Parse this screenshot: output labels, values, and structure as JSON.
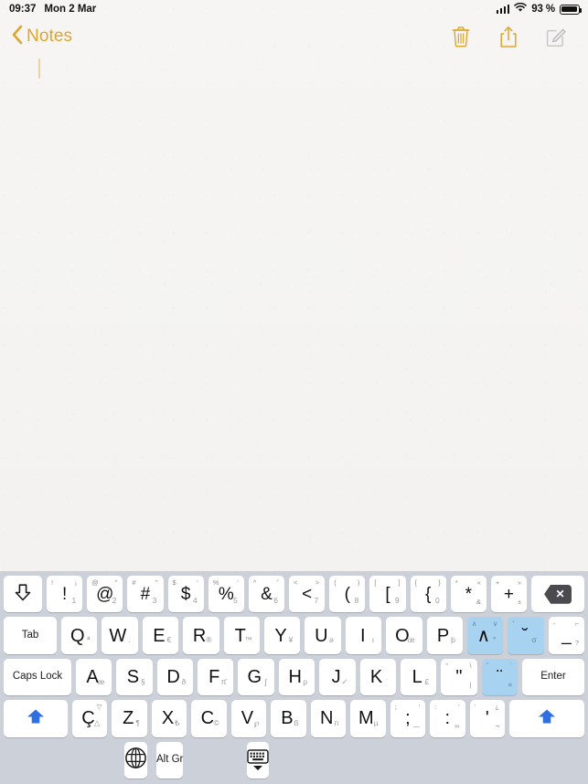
{
  "status_bar": {
    "time": "09:37",
    "date": "Mon 2 Mar",
    "battery_percent": "93 %",
    "signal_icon": "cellular-signal-icon",
    "wifi_icon": "wifi-icon",
    "battery_icon": "battery-icon"
  },
  "nav_bar": {
    "back_label": "Notes",
    "back_chevron_icon": "chevron-left-icon",
    "delete_icon": "trash-icon",
    "share_icon": "share-icon",
    "compose_icon": "compose-icon",
    "accent_color": "#e0a52b",
    "disabled_color": "#bdbdbd"
  },
  "note": {
    "body_text": "",
    "cursor_color": "#e3c98a"
  },
  "keyboard": {
    "layout_name": "Turkish Q",
    "background_color": "#ccd0d8",
    "key_color": "#ffffff",
    "highlight_color": "#a8d3f0",
    "rows": [
      {
        "name": "number-row",
        "keys": [
          {
            "name": "tab-down-key",
            "main": "⇩",
            "type": "icon-tab-down"
          },
          {
            "name": "exclamation-key",
            "main": "!",
            "tl": "!",
            "tr": "¡",
            "sub": "1"
          },
          {
            "name": "at-key",
            "main": "@",
            "tl": "@",
            "tr": "\"",
            "sub": "2"
          },
          {
            "name": "hash-key",
            "main": "#",
            "tl": "#",
            "tr": "\"",
            "sub": "3"
          },
          {
            "name": "dollar-key",
            "main": "$",
            "tl": "$",
            "tr": "'",
            "sub": "4"
          },
          {
            "name": "percent-key",
            "main": "%",
            "tl": "%",
            "tr": "'",
            "sub": "5"
          },
          {
            "name": "ampersand-key",
            "main": "&",
            "tl": "^",
            "tr": "˘",
            "sub": "6"
          },
          {
            "name": "less-than-key",
            "main": "<",
            "tl": "<",
            "tr": ">",
            "sub": "7"
          },
          {
            "name": "paren-open-key",
            "main": "(",
            "tl": "(",
            "tr": ")",
            "sub": "8"
          },
          {
            "name": "bracket-open-key",
            "main": "[",
            "tl": "[",
            "tr": "]",
            "sub": "9"
          },
          {
            "name": "brace-open-key",
            "main": "{",
            "tl": "{",
            "tr": "}",
            "sub": "0"
          },
          {
            "name": "asterisk-key",
            "main": "*",
            "tl": "*",
            "tr": "«",
            "br": "&"
          },
          {
            "name": "plus-key",
            "main": "+",
            "tl": "+",
            "tr": "»",
            "br": "±"
          },
          {
            "name": "backspace-key",
            "main": "⌫",
            "type": "icon-delete"
          }
        ]
      },
      {
        "name": "qwerty-row",
        "keys": [
          {
            "name": "tab-key",
            "main": "Tab",
            "type": "label"
          },
          {
            "name": "q-key",
            "main": "Q",
            "sub": "ª",
            "type": "letter"
          },
          {
            "name": "w-key",
            "main": "W",
            "sub": ".",
            "type": "letter"
          },
          {
            "name": "e-key",
            "main": "E",
            "sub": "€",
            "type": "letter"
          },
          {
            "name": "r-key",
            "main": "R",
            "sub": "®",
            "type": "letter"
          },
          {
            "name": "t-key",
            "main": "T",
            "sub": "™",
            "type": "letter"
          },
          {
            "name": "y-key",
            "main": "Y",
            "sub": "¥",
            "type": "letter"
          },
          {
            "name": "u-key",
            "main": "U",
            "sub": "ə",
            "type": "letter"
          },
          {
            "name": "i-key",
            "main": "I",
            "sub": "ı",
            "type": "letter"
          },
          {
            "name": "o-key",
            "main": "O",
            "sub": "œ",
            "type": "letter"
          },
          {
            "name": "p-key",
            "main": "P",
            "sub": "þ",
            "type": "letter"
          },
          {
            "name": "circumflex-key",
            "main": "∧",
            "tl": "∧",
            "tr": "∨",
            "sub": "°",
            "highlight": true,
            "type": "letter"
          },
          {
            "name": "breve-key",
            "main": "˘",
            "tl": "˘",
            "sub": "σ",
            "highlight": true,
            "type": "letter"
          },
          {
            "name": "underscore-key",
            "main": "_",
            "tl": "-",
            "tr": "⌐",
            "br": "?"
          }
        ]
      },
      {
        "name": "home-row",
        "keys": [
          {
            "name": "caps-lock-key",
            "main": "Caps Lock",
            "type": "label"
          },
          {
            "name": "a-key",
            "main": "A",
            "sub": "æ",
            "type": "letter"
          },
          {
            "name": "s-key",
            "main": "S",
            "sub": "§",
            "type": "letter"
          },
          {
            "name": "d-key",
            "main": "D",
            "sub": "ð",
            "type": "letter"
          },
          {
            "name": "f-key",
            "main": "F",
            "sub": "π̄",
            "type": "letter"
          },
          {
            "name": "g-key",
            "main": "G",
            "sub": "∫",
            "type": "letter"
          },
          {
            "name": "h-key",
            "main": "H",
            "sub": "ρ",
            "type": "letter"
          },
          {
            "name": "j-key",
            "main": "J",
            "sub": "✓",
            "type": "letter"
          },
          {
            "name": "k-key",
            "main": "K",
            "sub": "˙",
            "type": "letter"
          },
          {
            "name": "l-key",
            "main": "L",
            "sub": "£",
            "type": "letter"
          },
          {
            "name": "quote-key",
            "main": "\"",
            "tl": "\"",
            "tr": "\\",
            "br": "|",
            "type": "punct"
          },
          {
            "name": "diaeresis-key",
            "main": "¨",
            "tl": "˝",
            "tr": "´",
            "br": "¤",
            "highlight": true,
            "type": "punct"
          },
          {
            "name": "enter-key",
            "main": "Enter",
            "type": "label"
          }
        ]
      },
      {
        "name": "shift-row",
        "keys": [
          {
            "name": "shift-left-key",
            "main": "⬆",
            "type": "icon-shift"
          },
          {
            "name": "c-cedilla-key",
            "main": "Ç",
            "tr": "▽",
            "sub": "△",
            "type": "letter"
          },
          {
            "name": "z-key",
            "main": "Z",
            "sub": "¶",
            "type": "letter"
          },
          {
            "name": "x-key",
            "main": "X",
            "sub": "₺",
            "type": "letter"
          },
          {
            "name": "c-key",
            "main": "C",
            "sub": "©",
            "type": "letter"
          },
          {
            "name": "v-key",
            "main": "V",
            "sub": "℘",
            "type": "letter"
          },
          {
            "name": "b-key",
            "main": "B",
            "sub": "ß",
            "type": "letter"
          },
          {
            "name": "n-key",
            "main": "N",
            "sub": "п",
            "type": "letter"
          },
          {
            "name": "m-key",
            "main": "M",
            "sub": "µ",
            "type": "letter"
          },
          {
            "name": "semicolon-key",
            "main": ";",
            "tl": ";",
            "tr": "'",
            "br": "—",
            "type": "punct"
          },
          {
            "name": "colon-key",
            "main": ":",
            "tl": ":",
            "tr": "'",
            "br": "∞",
            "type": "punct"
          },
          {
            "name": "apostrophe-key",
            "main": "'",
            "tl": "'",
            "tr": "¿",
            "br": "¬",
            "type": "punct"
          },
          {
            "name": "shift-right-key",
            "main": "⬆",
            "type": "icon-shift"
          }
        ]
      },
      {
        "name": "space-row",
        "keys": [
          {
            "name": "globe-key",
            "main": "🌐",
            "type": "icon-globe"
          },
          {
            "name": "space-key",
            "main": "",
            "type": "space"
          },
          {
            "name": "alt-gr-key",
            "main": "Alt Gr",
            "type": "label"
          },
          {
            "name": "dismiss-keyboard-key",
            "main": "",
            "type": "icon-dismiss"
          }
        ]
      }
    ]
  }
}
